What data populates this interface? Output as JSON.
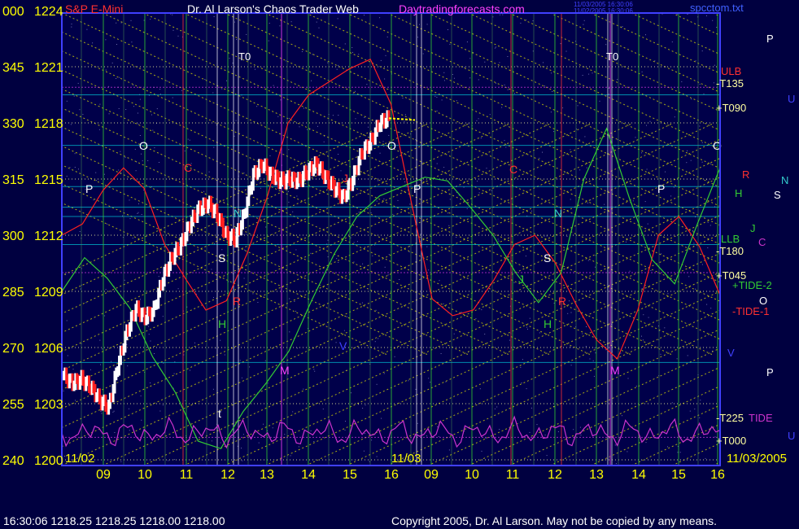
{
  "header": {
    "chart_name": "S&P E-Mini",
    "publisher": "Dr. Al Larson's Chaos Trader Web",
    "website": "Daytradingforecasts.com",
    "file_name": "spcctom.txt",
    "timestamp_line1": "11/03/2005 16:30:06",
    "timestamp_line2": "11/02/2005 16:30:06"
  },
  "footer": {
    "ohlc": "16:30:06  1218.25 1218.25 1218.00 1218.00",
    "copyright": "Copyright 2005, Dr. Al Larson. May not be copied by any means."
  },
  "colors": {
    "background": "#000040",
    "price_up": "#ffffff",
    "price_down": "#ff2020",
    "grid_vertical": "#33cc33",
    "grid_horizontal": "#00ffff",
    "diagonal": "#e6e600",
    "tide_1": "#ff2020",
    "tide_2": "#33cc33",
    "tide_indicator": "#cc33cc",
    "axis_text": "#ffff00"
  },
  "chart_data": {
    "type": "line",
    "y_axis": {
      "degree_ticks": [
        "000",
        "345",
        "330",
        "315",
        "300",
        "285",
        "270",
        "255",
        "240"
      ],
      "price_ticks": [
        1224,
        1221,
        1218,
        1215,
        1212,
        1209,
        1206,
        1203,
        1200
      ],
      "ylim": [
        1200,
        1224
      ]
    },
    "x_axis": {
      "dates": [
        "11/02",
        "11/03",
        "11/03/2005"
      ],
      "hour_ticks": [
        "09",
        "10",
        "11",
        "12",
        "13",
        "14",
        "15",
        "16",
        "09",
        "10",
        "11",
        "12",
        "13",
        "14",
        "15",
        "16"
      ]
    },
    "right_labels": {
      "ulb": "ULB",
      "t135": "-T135",
      "t090": "+T090",
      "llb": "LLB",
      "t180": "-T180",
      "t045": "+T045",
      "tide2": "+TIDE-2",
      "tide1": "-TIDE-1",
      "t225": "-T225",
      "tide": "TIDE",
      "m000": "+T000"
    },
    "far_right_letters": [
      "P",
      "U",
      "R",
      "N",
      "H",
      "S",
      "J",
      "C",
      "O",
      "V",
      "P",
      "U"
    ],
    "markers": {
      "t0": "T0",
      "planet_letters": [
        "O",
        "C",
        "P",
        "N",
        "S",
        "H",
        "R",
        "M",
        "J",
        "V",
        "t",
        "O",
        "P",
        "C",
        "N",
        "J",
        "S",
        "H",
        "R",
        "M",
        "P",
        "O"
      ]
    },
    "series": [
      {
        "name": "S&P E-Mini",
        "role": "price",
        "values": [
          1204.5,
          1204.1,
          1204.3,
          1203.9,
          1203.2,
          1202.8,
          1205.0,
          1206.8,
          1208.1,
          1207.6,
          1208.0,
          1209.7,
          1210.8,
          1211.5,
          1212.6,
          1213.4,
          1213.7,
          1213.1,
          1212.0,
          1211.8,
          1213.1,
          1215.2,
          1215.8,
          1215.2,
          1214.9,
          1215.0,
          1214.9,
          1215.4,
          1215.8,
          1215.1,
          1214.5,
          1214.0,
          1215.0,
          1216.4,
          1217.0,
          1218.0,
          1218.25
        ]
      },
      {
        "name": "TIDE-1",
        "role": "indicator",
        "values": [
          1212,
          1212.6,
          1214.4,
          1215.6,
          1214.5,
          1211.5,
          1209.7,
          1208.0,
          1208.5,
          1211.0,
          1214.1,
          1218.0,
          1219.5,
          1220.2,
          1220.9,
          1221.4,
          1219.0,
          1213.7,
          1208.6,
          1207.7,
          1208.0,
          1209.6,
          1211.5,
          1212.0,
          1210.5,
          1208.3,
          1206.4,
          1205.4,
          1208.0,
          1212.0,
          1213.0,
          1211.4,
          1208.8
        ]
      },
      {
        "name": "TIDE-2",
        "role": "indicator",
        "values": [
          1209.0,
          1210.8,
          1209.7,
          1208.1,
          1205.5,
          1203.6,
          1201.0,
          1200.6,
          1202.6,
          1204.1,
          1205.8,
          1208.5,
          1211.0,
          1213.0,
          1214.1,
          1214.6,
          1215.1,
          1214.9,
          1213.5,
          1212.0,
          1210.0,
          1208.4,
          1210.0,
          1215.0,
          1217.7,
          1214.0,
          1210.7,
          1209.4,
          1212.6,
          1215.6
        ]
      }
    ]
  }
}
